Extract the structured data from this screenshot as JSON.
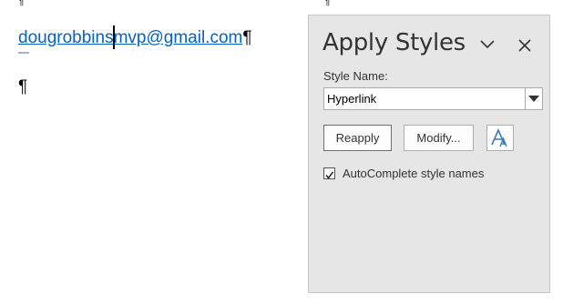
{
  "document": {
    "top_marks": [
      "¶",
      "¶"
    ],
    "email_link": "dougrobbinsmvp@gmail.com",
    "pilcrow": "¶"
  },
  "pane": {
    "title": "Apply Styles",
    "style_name_label": "Style Name:",
    "style_name_value": "Hyperlink",
    "reapply_label": "Reapply",
    "modify_label": "Modify...",
    "autocomplete_label": "AutoComplete style names",
    "autocomplete_checked": true,
    "icons": [
      "chevron-down-icon",
      "close-icon",
      "dropdown-arrow-icon",
      "styles-pane-icon",
      "checkmark-icon"
    ],
    "colors": {
      "link": "#0563c1",
      "pane_bg": "#e6e6e6",
      "accent": "#3c7bb8"
    }
  }
}
